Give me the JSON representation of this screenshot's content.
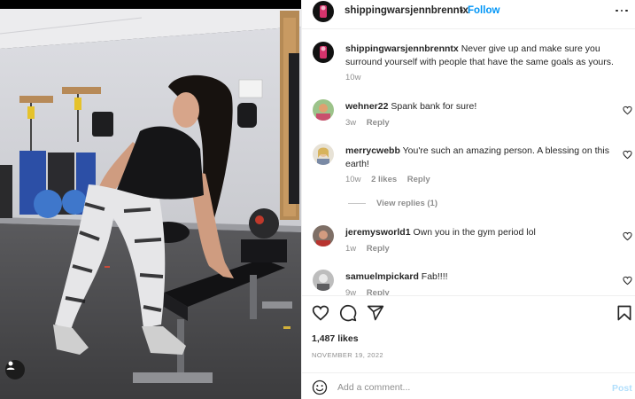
{
  "post": {
    "author": "shippingwarsjennbrenntx",
    "follow_label": "Follow",
    "dot": "•",
    "caption": "Never give up and make sure you surround yourself with people that have the same goals as yours.",
    "caption_age": "10w",
    "likes": "1,487 likes",
    "date": "NOVEMBER 19, 2022"
  },
  "comments": [
    {
      "user": "wehner22",
      "text": "Spank bank for sure!",
      "age": "3w",
      "likes": "",
      "reply": "Reply"
    },
    {
      "user": "merrycwebb",
      "text": "You're such an amazing person. A blessing on this earth!",
      "age": "10w",
      "likes": "2 likes",
      "reply": "Reply",
      "view_replies": "View replies (1)"
    },
    {
      "user": "jeremysworld1",
      "text": "Own you in the gym period lol",
      "age": "1w",
      "likes": "",
      "reply": "Reply"
    },
    {
      "user": "samuelmpickard",
      "text": "Fab!!!!",
      "age": "9w",
      "likes": "",
      "reply": "Reply"
    }
  ],
  "add_comment": {
    "placeholder": "Add a comment...",
    "post_label": "Post"
  },
  "icons": {
    "more": "more-options-icon",
    "heart": "heart-icon",
    "comment": "comment-icon",
    "share": "share-icon",
    "save": "bookmark-icon",
    "emoji": "emoji-icon",
    "tag": "user-tag-icon"
  },
  "colors": {
    "accent": "#0095f6",
    "post_disabled": "#b2dffc",
    "muted": "#8e8e8e",
    "text": "#262626"
  }
}
